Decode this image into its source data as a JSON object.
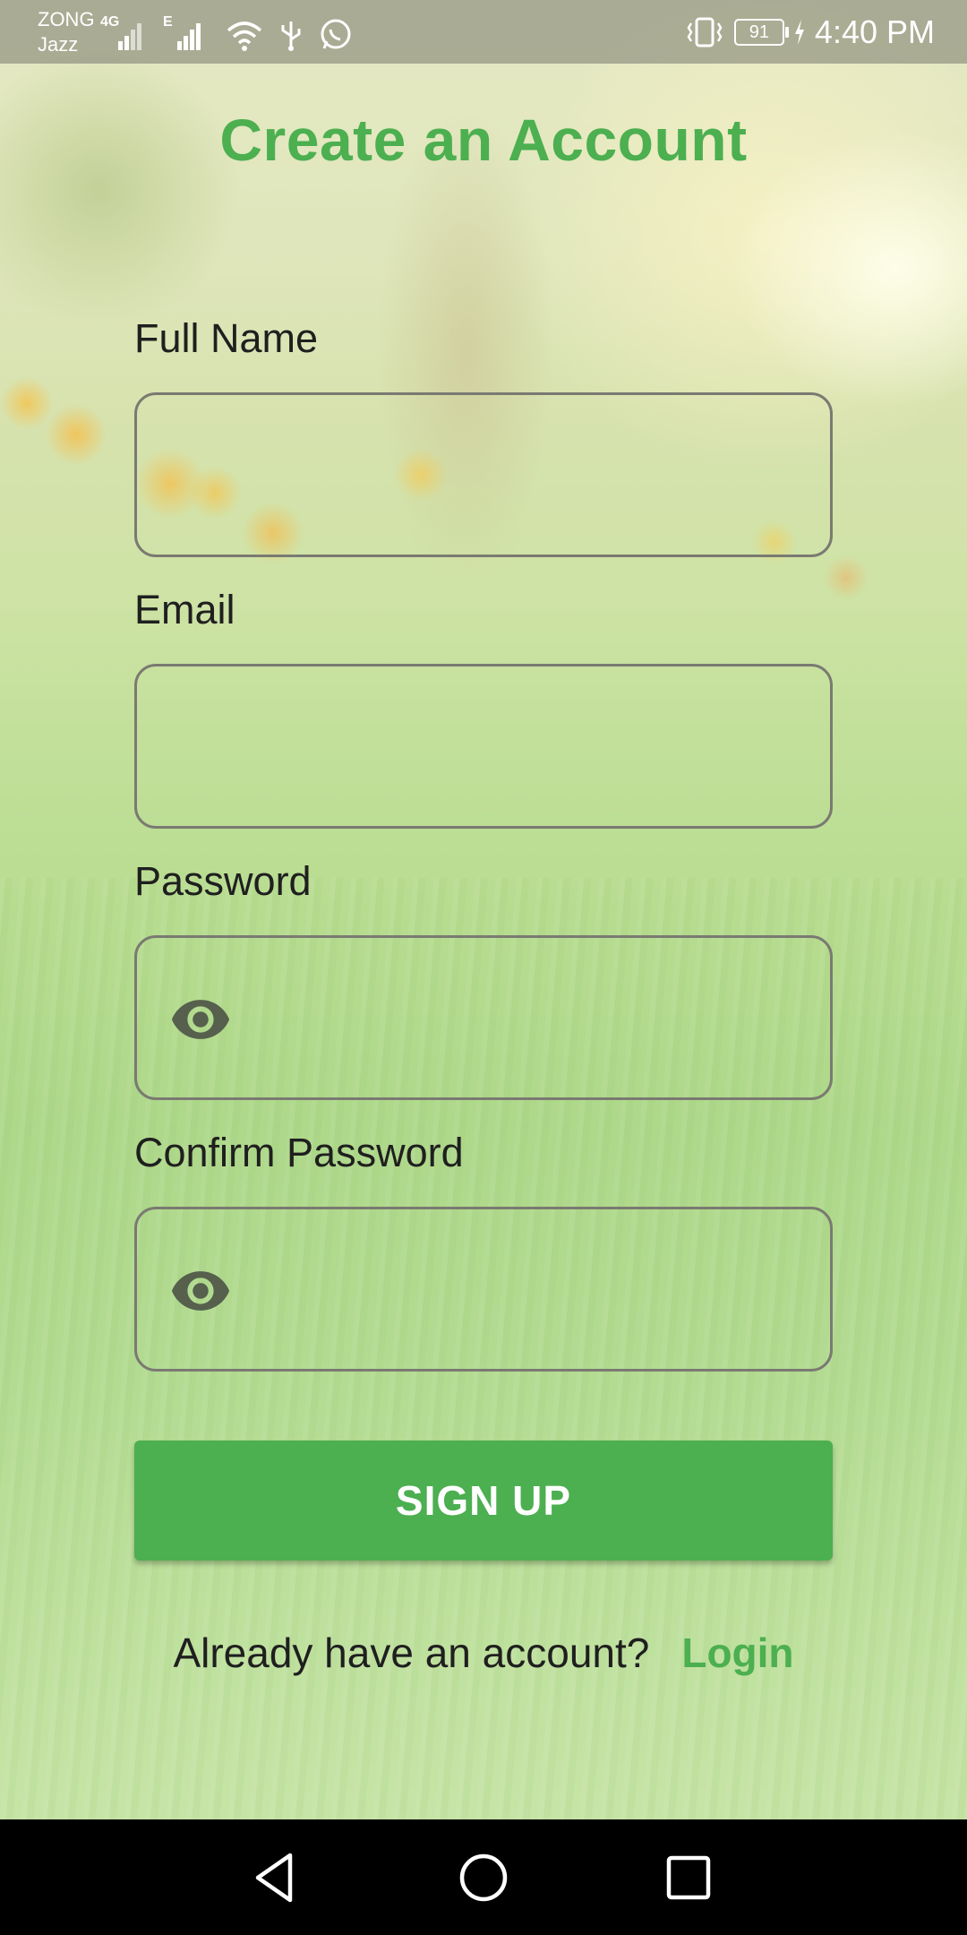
{
  "status_bar": {
    "carrier_primary": "ZONG",
    "carrier_secondary": "Jazz",
    "network_4g": "4G",
    "network_e": "E",
    "battery_level": "91",
    "time": "4:40 PM",
    "icons": [
      "signal-icon",
      "signal-icon",
      "wifi-icon",
      "usb-icon",
      "whatsapp-icon",
      "vibrate-icon",
      "battery-icon",
      "charging-icon"
    ]
  },
  "form": {
    "title": "Create an Account",
    "full_name": {
      "label": "Full Name",
      "value": ""
    },
    "email": {
      "label": "Email",
      "value": ""
    },
    "password": {
      "label": "Password",
      "value": "",
      "icon": "eye-icon"
    },
    "confirm_password": {
      "label": "Confirm Password",
      "value": "",
      "icon": "eye-icon"
    },
    "signup_label": "SIGN UP",
    "footer_text": "Already have an account?",
    "login_label": "Login"
  },
  "nav_bar": {
    "buttons": [
      "back-icon",
      "home-icon",
      "recents-icon"
    ]
  },
  "colors": {
    "accent": "#4caf50",
    "text": "#1f1f1f",
    "field_border": "#7a7a72",
    "eye_icon": "#56604d"
  }
}
